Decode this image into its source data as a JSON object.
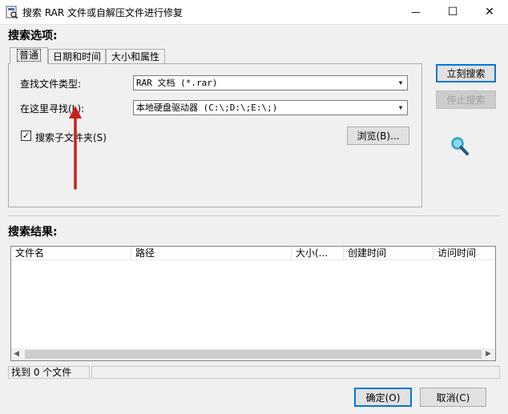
{
  "window": {
    "title": "搜索 RAR 文件或自解压文件进行修复",
    "minimize_glyph": "—",
    "maximize_glyph": "☐",
    "close_glyph": "✕"
  },
  "search_options": {
    "heading": "搜索选项:",
    "tabs": [
      {
        "label": "普通",
        "active": true
      },
      {
        "label": "日期和时间",
        "active": false
      },
      {
        "label": "大小和属性",
        "active": false
      }
    ],
    "file_type_label": "查找文件类型:",
    "file_type_value": "RAR 文档 (*.rar)",
    "look_in_label": "在这里寻找(L):",
    "look_in_value": "本地硬盘驱动器 (C:\\;D:\\;E:\\;)",
    "subfolders_label": "搜索子文件夹(S)",
    "subfolders_checked": true,
    "browse_label": "浏览(B)..."
  },
  "actions": {
    "search_now_label": "立刻搜索",
    "stop_search_label": "停止搜索"
  },
  "results": {
    "heading": "搜索结果:",
    "columns": [
      "文件名",
      "路径",
      "大小(...",
      "创建时间",
      "访问时间"
    ],
    "rows": []
  },
  "status": {
    "found_text": "找到 0 个文件"
  },
  "footer": {
    "ok_label": "确定(O)",
    "cancel_label": "取消(C)"
  },
  "colors": {
    "annotation_arrow": "#c8201e",
    "magnifier": "#2aa4c8",
    "accent": "#0078d7"
  },
  "icons": {
    "app": "app-icon",
    "magnifier": "magnifier-icon",
    "dropdown": "chevron-down-icon"
  }
}
